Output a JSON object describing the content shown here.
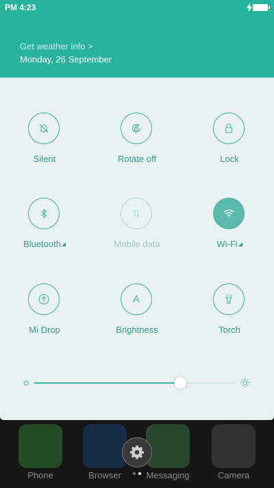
{
  "status_bar": {
    "time": "PM 4:23",
    "battery_icon": "battery-charging-icon"
  },
  "header": {
    "weather_link": "Get weather info >",
    "date": "Monday, 26 September"
  },
  "tiles": [
    {
      "label": "Silent",
      "icon": "bell-off-icon",
      "state": "off"
    },
    {
      "label": "Rotate off",
      "icon": "rotate-lock-icon",
      "state": "off"
    },
    {
      "label": "Lock",
      "icon": "lock-icon",
      "state": "off"
    },
    {
      "label": "Bluetooth",
      "icon": "bluetooth-icon",
      "state": "off",
      "expandable": true
    },
    {
      "label": "Mobile data",
      "icon": "mobile-data-icon",
      "state": "disabled"
    },
    {
      "label": "Wi-Fi",
      "icon": "wifi-icon",
      "state": "on",
      "expandable": true
    },
    {
      "label": "Mi Drop",
      "icon": "upload-icon",
      "state": "off"
    },
    {
      "label": "Brightness",
      "icon": "auto-brightness-icon",
      "state": "off"
    },
    {
      "label": "Torch",
      "icon": "flashlight-icon",
      "state": "off"
    }
  ],
  "brightness_slider": {
    "value_fraction": 0.73
  },
  "home_dock": {
    "apps": [
      "Phone",
      "Browser",
      "Messaging",
      "Camera"
    ],
    "settings_icon": "gear-icon"
  },
  "colors": {
    "accent": "#26b3a0",
    "panel_bg": "#eaf2f1",
    "tile_stroke": "#43b5a6",
    "tile_active": "#5ab8ad"
  }
}
